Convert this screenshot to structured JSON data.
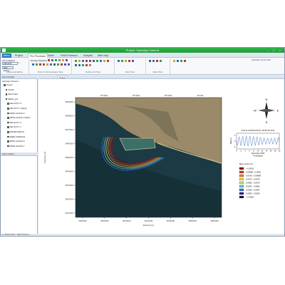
{
  "window": {
    "title": "Project: Hydrodyn 2new.dt"
  },
  "tabs": [
    {
      "label": "Menu",
      "style": "file"
    },
    {
      "label": "Project"
    },
    {
      "label": "Pre-Processor",
      "style": "sel"
    },
    {
      "label": "Solve"
    },
    {
      "label": "Post-Processor"
    },
    {
      "label": "Analysis"
    },
    {
      "label": "Web map"
    }
  ],
  "ribbon": {
    "list_label": "List of Objects",
    "list_value": "Standard",
    "manage_label": "Manage Database",
    "start_label": "Start Editing",
    "right_label": "Hydrodyn 16.16 (x64)",
    "group_captions": [
      "Objects and Editing",
      "Points & Grid Generation Tools",
      "Surface Grid Tools",
      "Mesh Tools",
      "Model Tools"
    ]
  },
  "left_panel": {
    "title": "Grid Content",
    "tree_title": "Hydrodyn Projects",
    "items": [
      "Project",
      "Terrain",
      "Mesh Data",
      "MESH_grd",
      "VELOCITY-X",
      "VELOCITY-Y(Mod)",
      "WIND-ALONG-X",
      "WIND-ALONG-Y(MAX)",
      "VELOCITY-X",
      "VELOCITY-Y",
      "WATER-DEPTH",
      "FREE-SURFACE",
      "WIND-ALONG-X",
      "WIND-ALONG-Y"
    ],
    "bottom_title": "Zoom Factor"
  },
  "map": {
    "tab_label": "Project",
    "x_ticks": [
      "3560000",
      "3562000",
      "3563000",
      "3561000",
      "3563000",
      "3565000",
      "3566000"
    ],
    "top_ticks": [
      "45°30'E",
      "45°40'E",
      "45°50'E",
      "46°0'E"
    ],
    "y_ticks": [
      "3949000",
      "3948000",
      "3947000",
      "3946000",
      "3945000",
      "3944000",
      "3943000",
      "3942000",
      "3941000"
    ],
    "xlabel": "Easting (m)",
    "ylabel": "Northing (m)",
    "compass": {
      "n": "N",
      "s": "S",
      "e": "E",
      "w": "W"
    },
    "colors": {
      "land": "#9a8a6a",
      "sea_deep": "#1c3a44",
      "sea_shallow": "#3a6f6a"
    }
  },
  "timeseries": {
    "title": "Tide at 21°06'10.84\"N, 49°54'15.72\"E",
    "ylabel": "Tide(m)",
    "xlabel": "Time(days)",
    "sublabel": "November 2015",
    "y_ticks": [
      "1",
      "0",
      "-1"
    ],
    "x_ticks": [
      "0",
      "2",
      "4",
      "6",
      "8",
      "10",
      "12",
      "14",
      "16",
      "18",
      "20"
    ]
  },
  "legend": {
    "title": "Bed Level (m)",
    "entries": [
      {
        "label": "> 0.0001",
        "color": "#8a1010"
      },
      {
        "label": "0.00086 - 0.0001",
        "color": "#d03030"
      },
      {
        "label": "0.0075 - 0.00086",
        "color": "#f07a20"
      },
      {
        "label": "0.0073 - 0.0075",
        "color": "#f0d040"
      },
      {
        "label": "0.0062 - 0.0073",
        "color": "#c0e060"
      },
      {
        "label": "0.0041 - 0.0062",
        "color": "#60c0e0"
      },
      {
        "label": "0.0020 - 0.0041",
        "color": "#3070d0"
      },
      {
        "label": "0.0000 - 0.0020",
        "color": "#202090"
      },
      {
        "label": "< 0.0000",
        "color": "#101040"
      }
    ]
  },
  "status": {
    "text": "X: 762374.354 Y: 3941775.547 m"
  }
}
